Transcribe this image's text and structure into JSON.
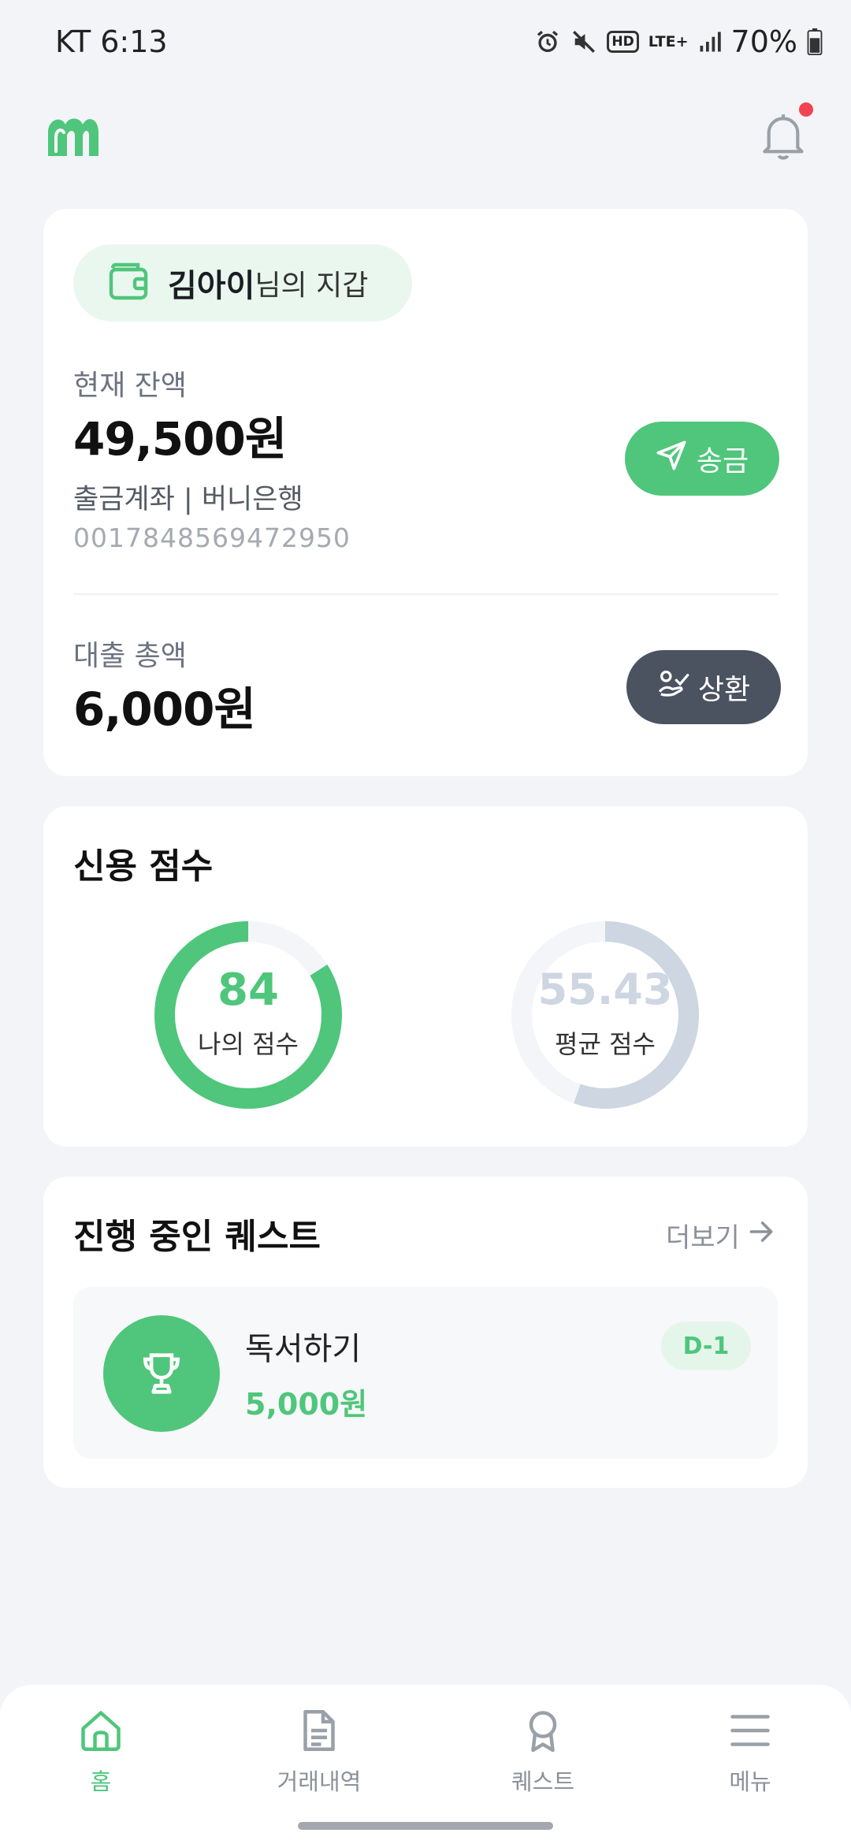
{
  "status_bar": {
    "carrier_time": "KT 6:13",
    "network": "LTE+",
    "hd": "HD",
    "battery": "70%",
    "icons": [
      "alarm-icon",
      "mute-icon",
      "hd-icon",
      "lte-icon",
      "signal-icon",
      "battery-icon"
    ]
  },
  "header": {
    "logo": "app-logo",
    "notification_icon": "bell-icon",
    "has_unread": true
  },
  "wallet": {
    "owner_name": "김아이",
    "owner_suffix": "님의 지갑",
    "balance_label": "현재 잔액",
    "balance_amount": "49,500원",
    "account_label": "출금계좌 | 버니은행",
    "account_number": "0017848569472950",
    "send_label": "송금",
    "loan_label": "대출 총액",
    "loan_amount": "6,000원",
    "repay_label": "상환"
  },
  "credit": {
    "title": "신용 점수",
    "my_score": "84",
    "my_score_label": "나의 점수",
    "my_score_fraction": 0.84,
    "avg_score": "55.43",
    "avg_score_label": "평균 점수",
    "avg_score_fraction": 0.5543,
    "colors": {
      "mine": "#4fc67b",
      "avg": "#cdd6e1",
      "track": "#f3f5f8"
    }
  },
  "quests": {
    "title": "진행 중인 퀘스트",
    "more_label": "더보기",
    "items": [
      {
        "name": "독서하기",
        "reward": "5,000원",
        "dday": "D-1",
        "icon": "trophy-icon"
      }
    ]
  },
  "nav": {
    "items": [
      {
        "label": "홈",
        "icon": "home-icon",
        "active": true
      },
      {
        "label": "거래내역",
        "icon": "document-icon",
        "active": false
      },
      {
        "label": "퀘스트",
        "icon": "award-icon",
        "active": false
      },
      {
        "label": "메뉴",
        "icon": "menu-icon",
        "active": false
      }
    ]
  },
  "accent_color": "#4fc67b"
}
